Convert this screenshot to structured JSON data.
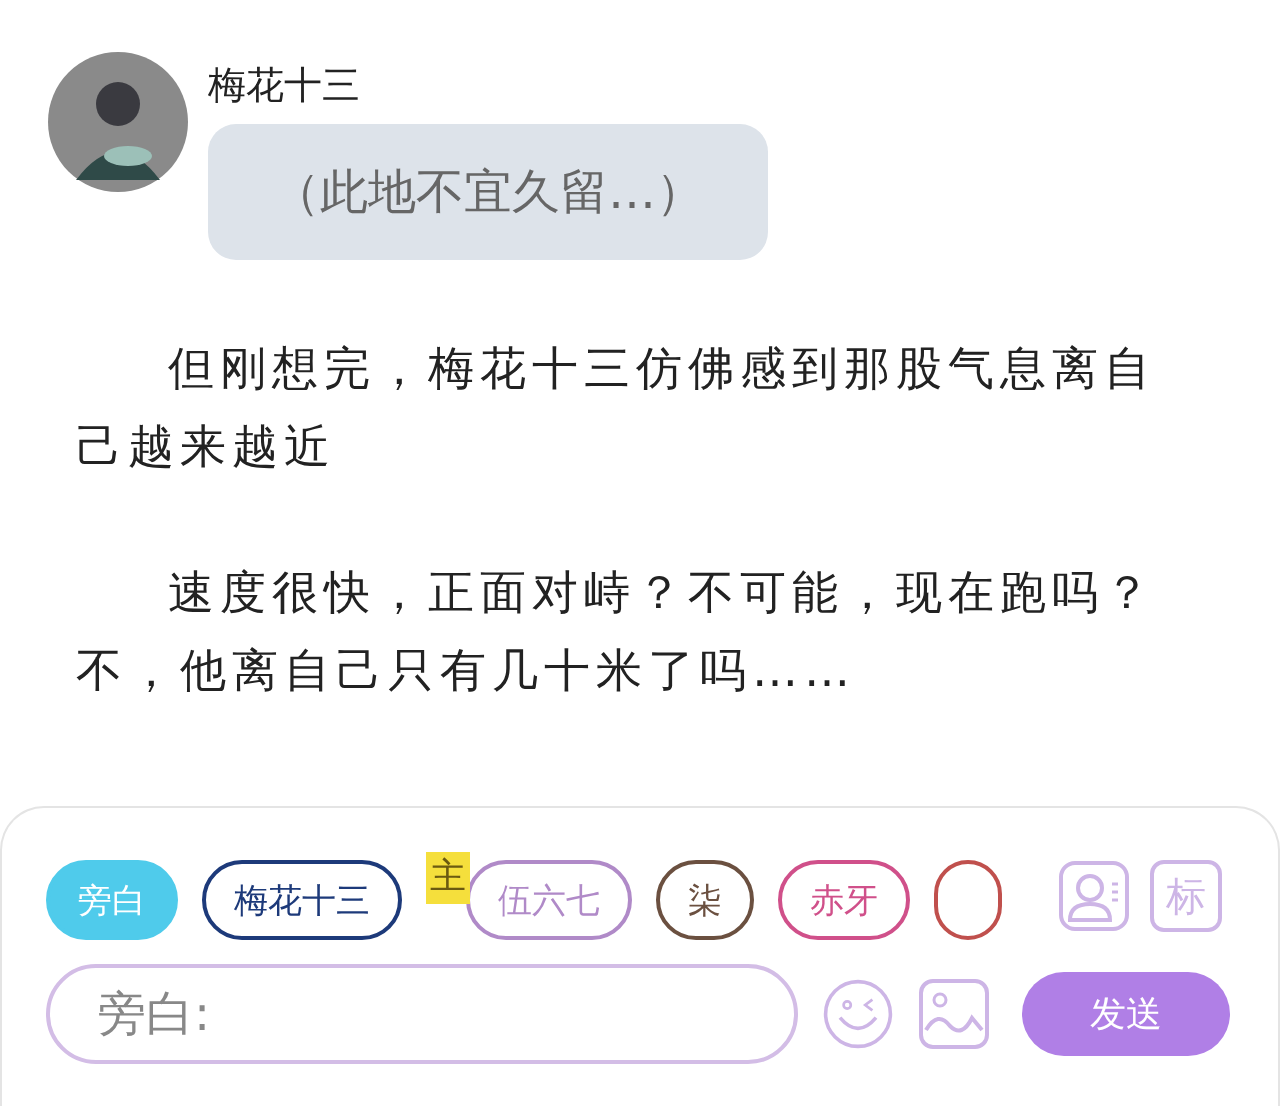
{
  "message": {
    "sender": "梅花十三",
    "text": "（此地不宜久留…）"
  },
  "narration": [
    "但刚想完，梅花十三仿佛感到那股气息离自己越来越近",
    "速度很快，正面对峙？不可能，现在跑吗？不，他离自己只有几十米了吗……"
  ],
  "characters": [
    {
      "label": "旁白",
      "color": "#4fcbeb",
      "selected": true
    },
    {
      "label": "梅花十三",
      "color": "#1d3a7a",
      "selected": false
    },
    {
      "label": "伍六七",
      "color": "#b08ac8",
      "selected": false,
      "badge": "主"
    },
    {
      "label": "柒",
      "color": "#6b5040",
      "selected": false
    },
    {
      "label": "赤牙",
      "color": "#d0508a",
      "selected": false
    },
    {
      "color": "#c0504d",
      "selected": false
    }
  ],
  "tag_button": "标",
  "input": {
    "placeholder": "旁白:"
  },
  "send_button": "发送"
}
